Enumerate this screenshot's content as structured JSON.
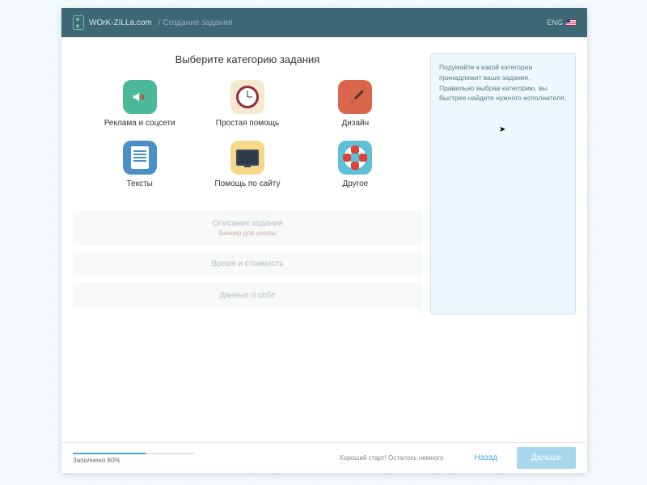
{
  "header": {
    "logo_text": "WOrK-ZILLa.com",
    "breadcrumb": "Создание задания",
    "lang": "ENG"
  },
  "main": {
    "title": "Выберите категорию задания",
    "categories": [
      {
        "label": "Реклама и соцсети"
      },
      {
        "label": "Простая помощь"
      },
      {
        "label": "Дизайн"
      },
      {
        "label": "Тексты"
      },
      {
        "label": "Помощь по сайту"
      },
      {
        "label": "Другое"
      }
    ],
    "tooltip": "Подумайте к какой категории принадлежит ваше задание. Правильно выбрав категорию, вы быстрее найдете нужного исполнителя."
  },
  "collapsed": [
    {
      "title": "Описание задания",
      "sub": "Баннер для школы"
    },
    {
      "title": "Время и стоимость",
      "sub": ""
    },
    {
      "title": "Данные о себе",
      "sub": ""
    }
  ],
  "footer": {
    "progress_pct": 60,
    "progress_label": "Заполнено 60%",
    "status": "Хороший старт! Осталось немного",
    "back": "Назад",
    "next": "Дальше"
  }
}
